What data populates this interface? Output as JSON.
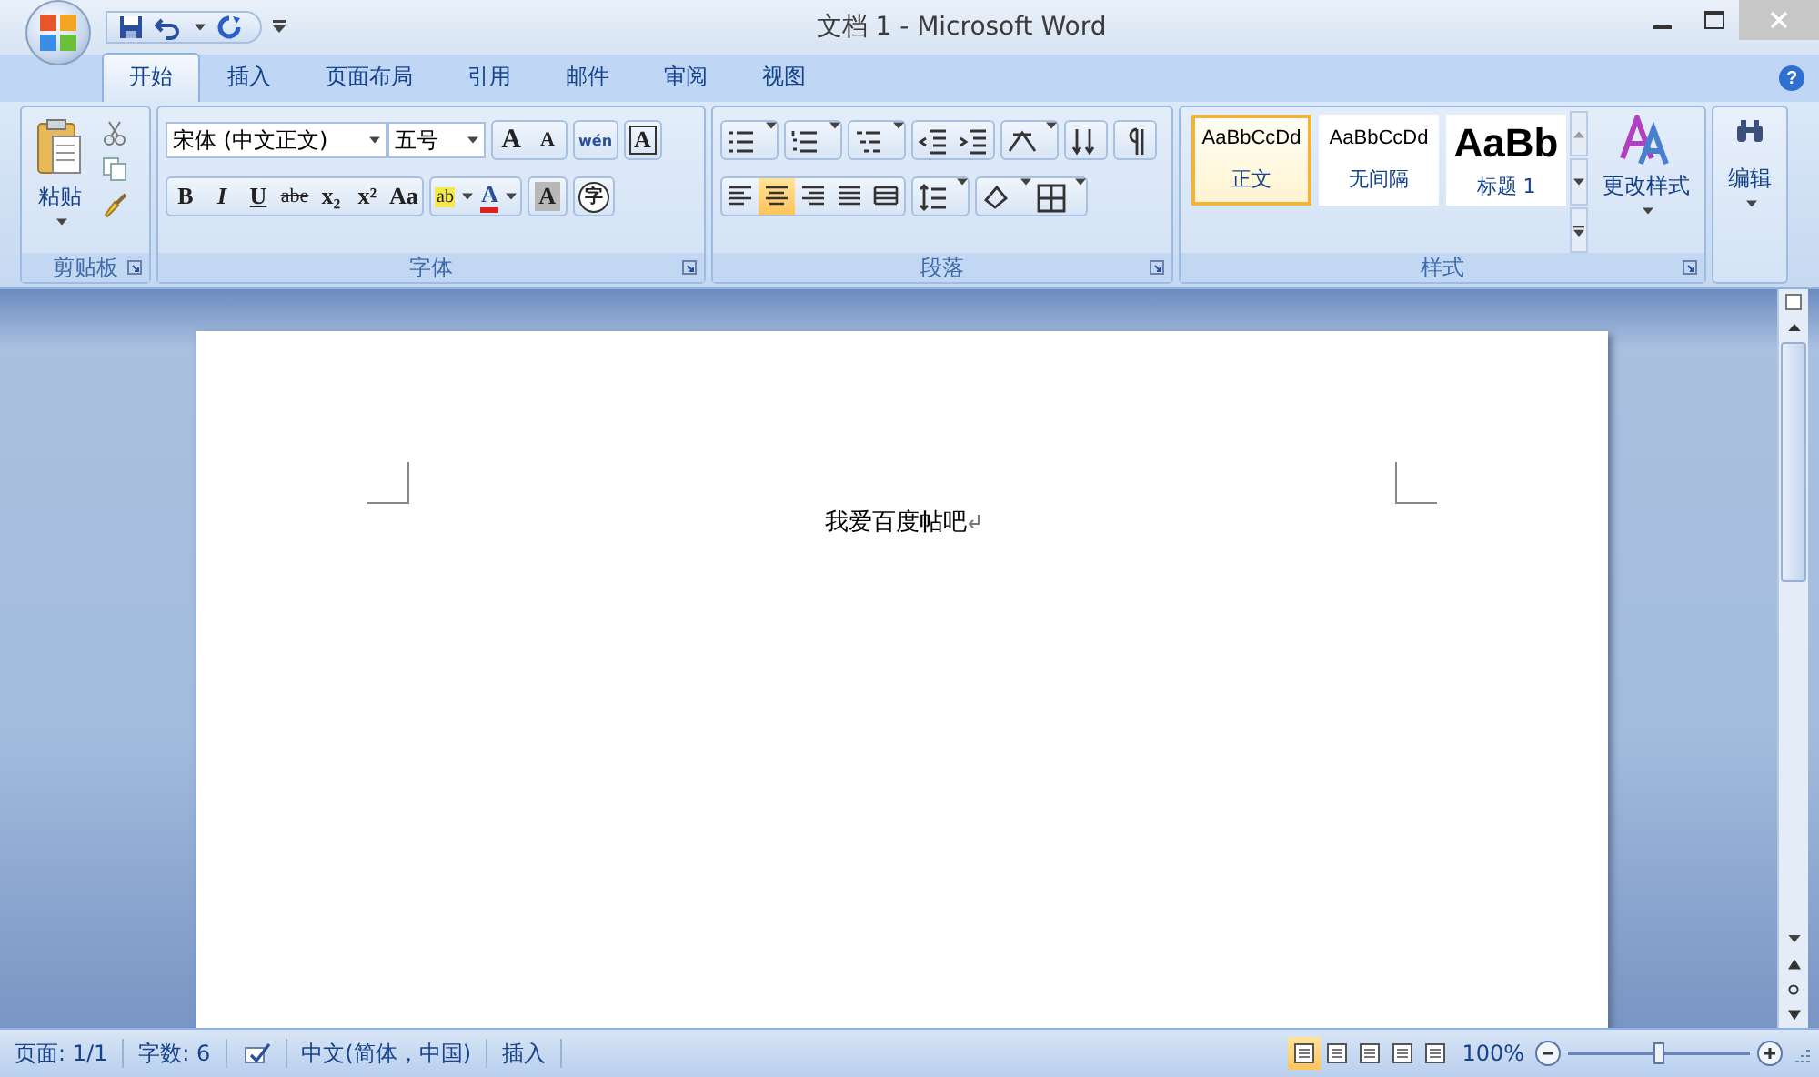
{
  "window": {
    "title": "文档 1 - Microsoft Word"
  },
  "tabs": [
    {
      "label": "开始",
      "selected": true
    },
    {
      "label": "插入",
      "selected": false
    },
    {
      "label": "页面布局",
      "selected": false
    },
    {
      "label": "引用",
      "selected": false
    },
    {
      "label": "邮件",
      "selected": false
    },
    {
      "label": "审阅",
      "selected": false
    },
    {
      "label": "视图",
      "selected": false
    }
  ],
  "help": {
    "glyph": "?"
  },
  "clipboard": {
    "paste": "粘贴",
    "label": "剪贴板"
  },
  "font": {
    "font_name": "宋体 (中文正文)",
    "font_size": "五号",
    "label": "字体",
    "format_buttons": [
      {
        "glyph": "B",
        "kind": "bold"
      },
      {
        "glyph": "I",
        "kind": "italic"
      },
      {
        "glyph": "U",
        "kind": "underline"
      },
      {
        "glyph": "abe",
        "kind": "strike"
      },
      {
        "glyph": "x₂",
        "kind": "plain"
      },
      {
        "glyph": "x²",
        "kind": "plain"
      },
      {
        "glyph": "Aa",
        "kind": "plain"
      }
    ],
    "top_buttons": [
      {
        "glyph": "A",
        "kind": "grow"
      },
      {
        "glyph": "A",
        "kind": "shrink"
      },
      {
        "glyph": "wén",
        "kind": "phonetic"
      },
      {
        "glyph": "A",
        "kind": "border"
      }
    ],
    "color_buttons": [
      {
        "glyph": "ab",
        "kind": "highlight",
        "color": "#f4e84a"
      },
      {
        "glyph": "A",
        "kind": "fontcolor",
        "color": "#e02020"
      },
      {
        "glyph": "A",
        "kind": "shade",
        "color": "#b8b8b8"
      },
      {
        "glyph": "字",
        "kind": "circle",
        "color": "#ffffff"
      }
    ]
  },
  "paragraph": {
    "label": "段落",
    "alignments": [
      {
        "selected": false
      },
      {
        "selected": true
      },
      {
        "selected": false
      },
      {
        "selected": false
      },
      {
        "selected": false
      }
    ]
  },
  "styles": {
    "label": "样式",
    "items": [
      {
        "preview": "AaBbCcDd",
        "name": "正文",
        "kind": "normal",
        "selected": true
      },
      {
        "preview": "AaBbCcDd",
        "name": "无间隔",
        "kind": "normal",
        "selected": false
      },
      {
        "preview": "AaBb",
        "name": "标题 1",
        "kind": "heading",
        "selected": false
      }
    ],
    "change_styles": "更改样式"
  },
  "editing": {
    "label": "编辑"
  },
  "document": {
    "text": "我爱百度帖吧"
  },
  "status_bar": {
    "page": "页面: 1/1",
    "words": "字数: 6",
    "language": "中文(简体，中国)",
    "mode": "插入",
    "views": [
      {
        "selected": true
      },
      {
        "selected": false
      },
      {
        "selected": false
      },
      {
        "selected": false
      },
      {
        "selected": false
      }
    ],
    "zoom": "100%",
    "zoom_level": {
      "level": 0.5
    }
  }
}
